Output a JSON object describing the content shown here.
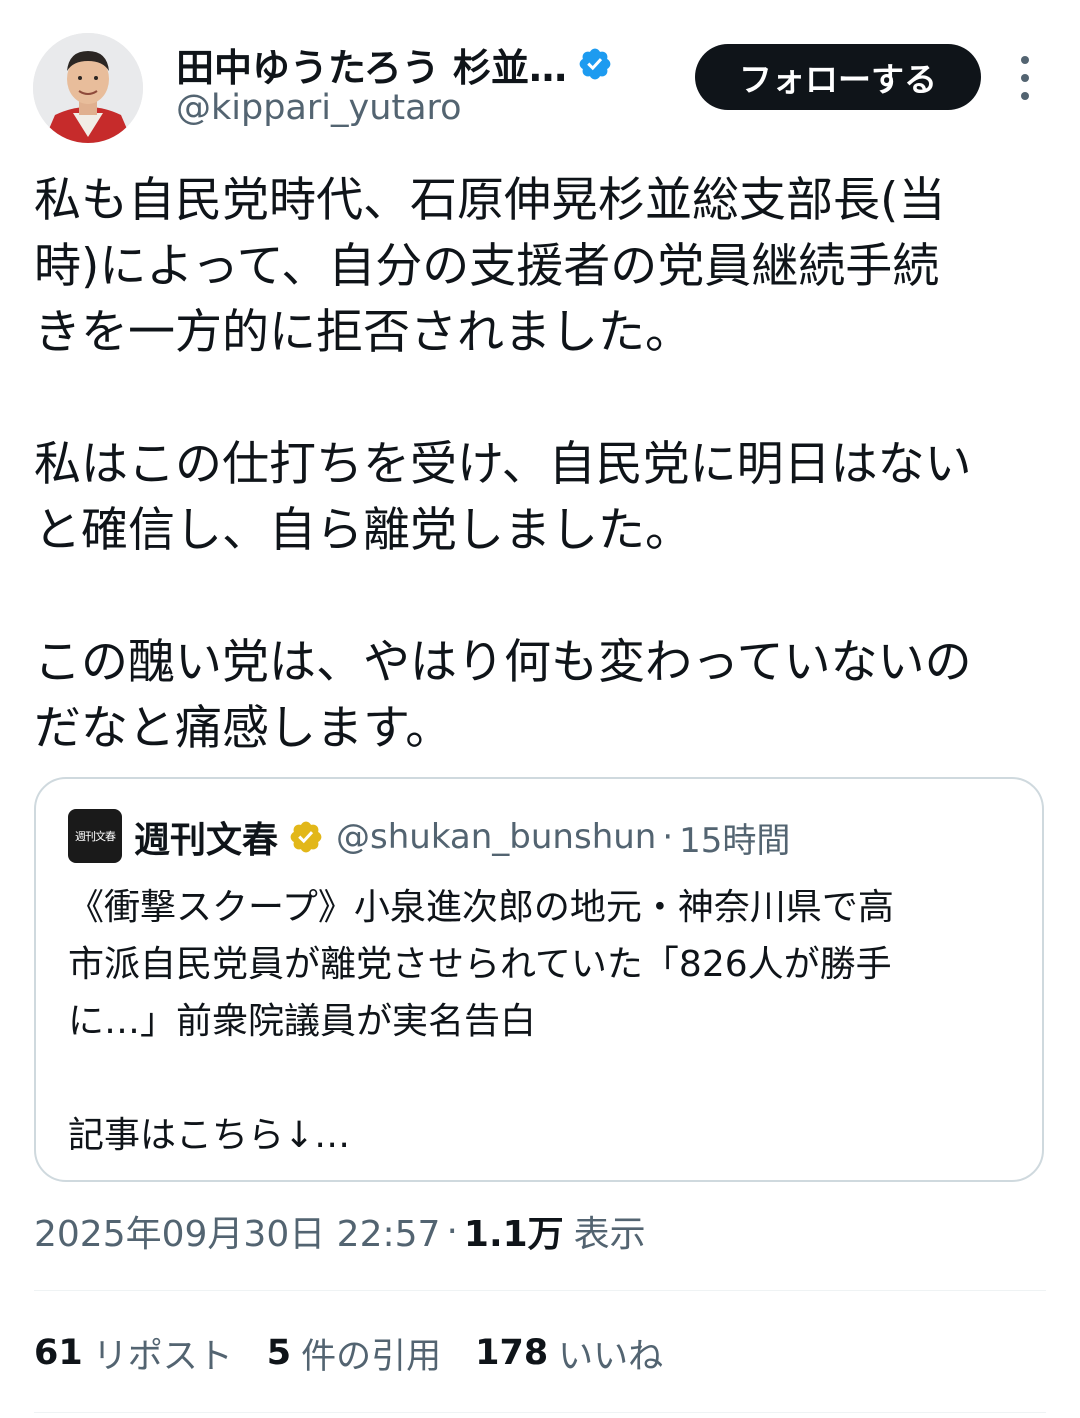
{
  "author": {
    "display_name": "田中ゆうたろう 杉並…",
    "handle": "@kippari_yutaro",
    "verified": true
  },
  "follow_label": "フォローする",
  "tweet_text": "私も自民党時代、石原伸晃杉並総支部長(当\n時)によって、自分の支援者の党員継続手続\nきを一方的に拒否されました。\n\n私はこの仕打ちを受け、自民党に明日はない\nと確信し、自ら離党しました。\n\nこの醜い党は、やはり何も変わっていないの\nだなと痛感します。",
  "quoted": {
    "logo_text": "週刊文春",
    "name": "週刊文春",
    "handle": "@shukan_bunshun",
    "separator": "·",
    "time": "15時間",
    "text": "《衝撃スクープ》小泉進次郎の地元・神奈川県で高\n市派自民党員が離党させられていた「826人が勝手\nに…」前衆院議員が実名告白\n\n記事はこちら↓…"
  },
  "meta": {
    "date": "2025年09月30日 22:57",
    "separator": "·",
    "views_count": "1.1万",
    "views_label": "表示"
  },
  "stats": {
    "reposts_count": "61",
    "reposts_label": "リポスト",
    "quotes_count": "5",
    "quotes_label": "件の引用",
    "likes_count": "178",
    "likes_label": "いいね"
  },
  "colors": {
    "verified_blue": "#1d9bf0",
    "verified_gold": "#e2b719",
    "secondary_text": "#536471",
    "border": "#cfd9de"
  }
}
